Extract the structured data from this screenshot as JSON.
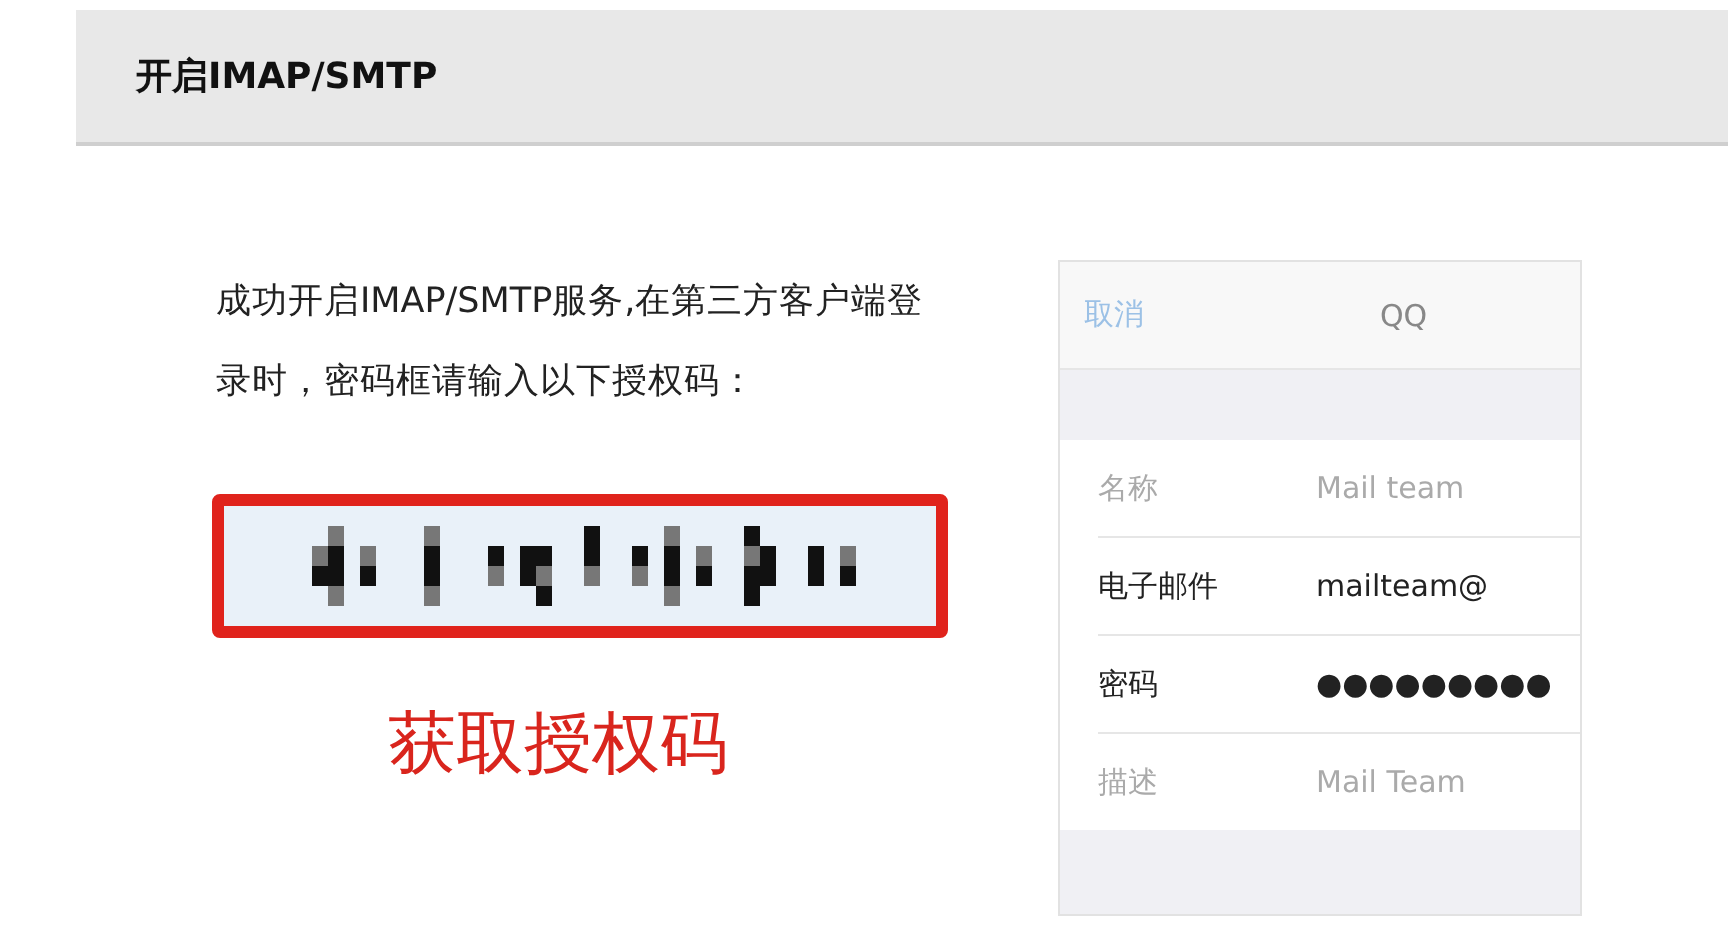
{
  "header": {
    "title": "开启IMAP/SMTP"
  },
  "message": "成功开启IMAP/SMTP服务,在第三方客户端登录时，密码框请输入以下授权码：",
  "caption": "获取授权码",
  "phone_form": {
    "cancel": "取消",
    "title": "QQ",
    "rows": [
      {
        "label": "名称",
        "placeholder": "Mail team"
      },
      {
        "label": "电子邮件",
        "value": "mailteam@"
      },
      {
        "label": "密码",
        "value": "●●●●●●●●●"
      },
      {
        "label": "描述",
        "placeholder": "Mail Team"
      }
    ]
  }
}
